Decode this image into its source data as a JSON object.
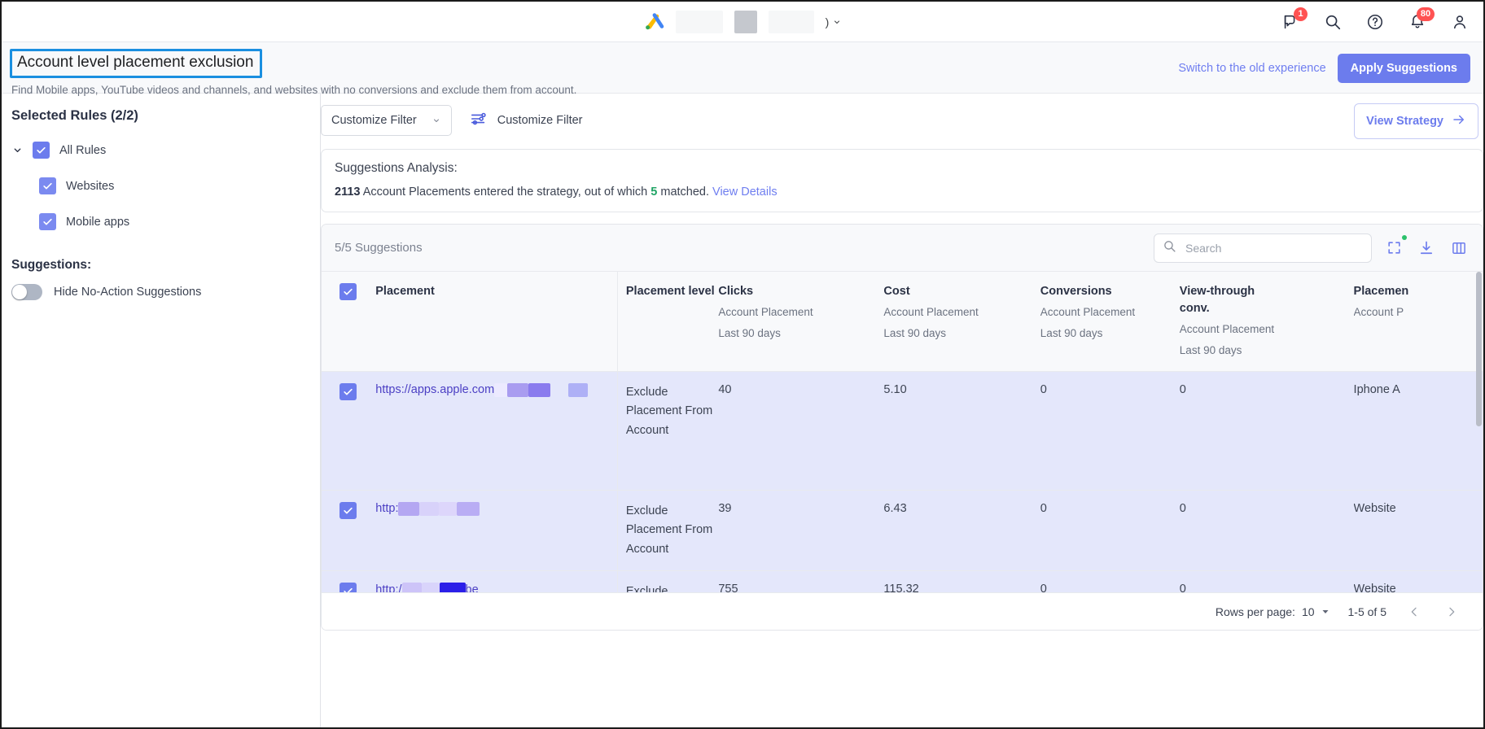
{
  "topnav": {
    "logo": "google-ads-logo",
    "account_chevron": ")",
    "icons": [
      {
        "name": "feedback-icon",
        "badge": "1"
      },
      {
        "name": "search-icon",
        "badge": ""
      },
      {
        "name": "help-icon",
        "badge": ""
      },
      {
        "name": "notifications-bell-icon",
        "badge": "80"
      },
      {
        "name": "account-avatar-icon",
        "badge": ""
      }
    ]
  },
  "header": {
    "title": "Account level placement exclusion",
    "subtitle": "Find Mobile apps, YouTube videos and channels, and websites with no conversions and exclude them from account.",
    "switch_link": "Switch to the old experience",
    "apply_button": "Apply Suggestions"
  },
  "sidebar": {
    "selected_rules_title": "Selected Rules (2/2)",
    "rules": [
      {
        "label": "All Rules",
        "checked": true,
        "level": 0
      },
      {
        "label": "Websites",
        "checked": true,
        "level": 1
      },
      {
        "label": "Mobile apps",
        "checked": true,
        "level": 1
      }
    ],
    "suggestions_title": "Suggestions:",
    "hide_toggle_label": "Hide No-Action Suggestions",
    "hide_toggle_on": false
  },
  "toolbar": {
    "filter_select_value": "Customize Filter",
    "customize_filter_link": "Customize Filter",
    "view_strategy_button": "View Strategy"
  },
  "analysis": {
    "heading": "Suggestions Analysis:",
    "count_total": "2113",
    "text_1": " Account Placements entered the strategy, out of which ",
    "count_matched": "5",
    "text_2": " matched. ",
    "details_link": "View Details"
  },
  "table": {
    "count_label": "5/5 Suggestions",
    "search_placeholder": "Search",
    "search_value": "",
    "header_all_checked": true,
    "columns": [
      {
        "main": "Placement",
        "sub1": "",
        "sub2": ""
      },
      {
        "main": "Placement level",
        "sub1": "",
        "sub2": ""
      },
      {
        "main": "Clicks",
        "sub1": "Account Placement",
        "sub2": "Last 90 days"
      },
      {
        "main": "Cost",
        "sub1": "Account Placement",
        "sub2": "Last 90 days"
      },
      {
        "main": "Conversions",
        "sub1": "Account Placement",
        "sub2": "Last 90 days"
      },
      {
        "main": "View-through conv.",
        "sub1": "Account Placement",
        "sub2": "Last 90 days"
      },
      {
        "main": "Placemen",
        "sub1": "Account P",
        "sub2": ""
      }
    ],
    "rows": [
      {
        "checked": true,
        "placement_text": "https://apps.apple.com",
        "placement_level": "Exclude Placement From Account",
        "clicks": "40",
        "cost": "5.10",
        "conversions": "0",
        "view_through_conv": "0",
        "placement_type": "Iphone A"
      },
      {
        "checked": true,
        "placement_text": "http:",
        "placement_level": "Exclude Placement From Account",
        "clicks": "39",
        "cost": "6.43",
        "conversions": "0",
        "view_through_conv": "0",
        "placement_type": "Website"
      },
      {
        "checked": true,
        "placement_text": "http:/",
        "placement_suffix": "be",
        "placement_level": "Exclude Placement From Account",
        "clicks": "755",
        "cost": "115.32",
        "conversions": "0",
        "view_through_conv": "0",
        "placement_type": "Website"
      }
    ],
    "footer": {
      "rows_per_page_label": "Rows per page:",
      "rows_per_page_value": "10",
      "range_label": "1-5 of 5"
    }
  },
  "colors": {
    "accent": "#6c7ced",
    "link": "#6f7ef0",
    "green": "#20a465",
    "badge_red": "#ff5252",
    "row_selected_bg": "#e4e7fb",
    "title_outline": "#1a8fe0"
  }
}
